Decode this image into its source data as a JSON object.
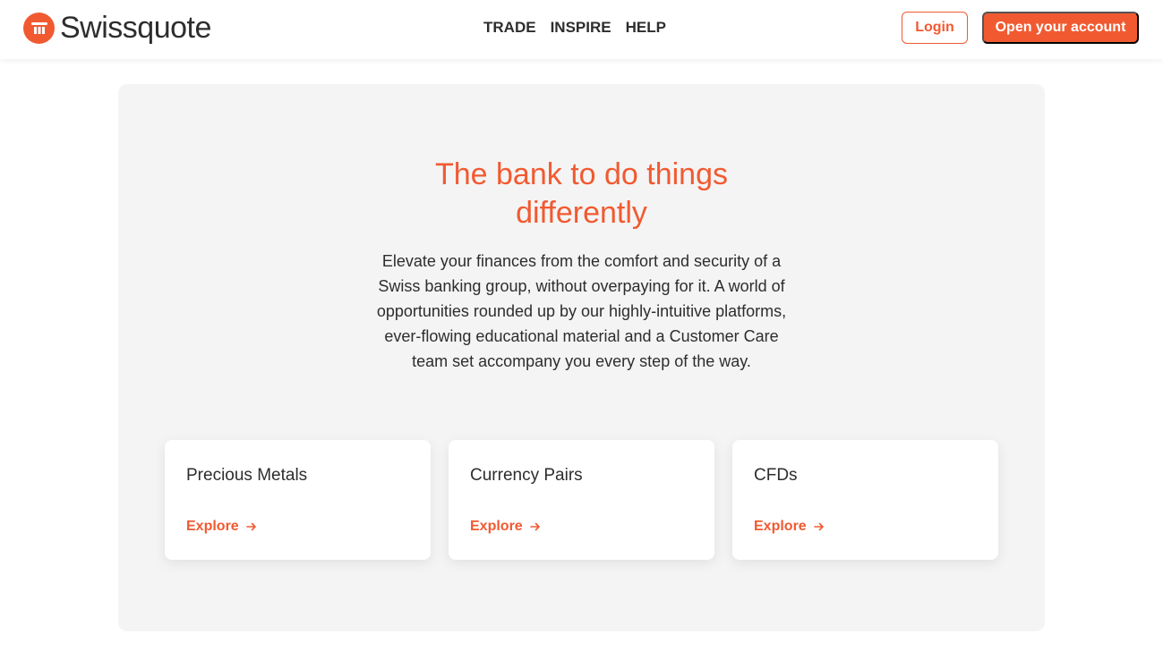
{
  "header": {
    "logo_text": "Swissquote",
    "nav": [
      {
        "label": "TRADE"
      },
      {
        "label": "INSPIRE"
      },
      {
        "label": "HELP"
      }
    ],
    "login_label": "Login",
    "open_account_label": "Open your account"
  },
  "hero": {
    "title_line1": "The bank to do things",
    "title_line2": "differently",
    "description": "Elevate your finances from the comfort and security of a Swiss banking group, without overpaying for it. A world of opportunities rounded up by our highly-intuitive platforms, ever-flowing educational material and a Customer Care team set accompany you every step of the way.",
    "cards": [
      {
        "title": "Precious Metals",
        "link": "Explore"
      },
      {
        "title": "Currency Pairs",
        "link": "Explore"
      },
      {
        "title": "CFDs",
        "link": "Explore"
      }
    ]
  },
  "colors": {
    "brand": "#f15a31",
    "text": "#2d2d2d",
    "panel": "#f4f4f4"
  },
  "icons": {
    "logo": "swissquote-logo-icon",
    "card_link": "arrow-right-icon"
  }
}
